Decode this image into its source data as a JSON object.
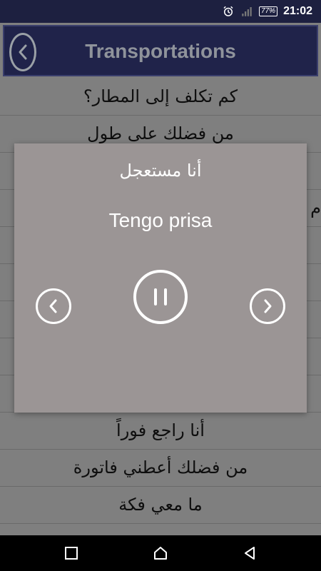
{
  "status_bar": {
    "time": "21:02",
    "battery": "77%",
    "icons": [
      "alarm-icon",
      "signal-icon",
      "battery-icon"
    ]
  },
  "header": {
    "title": "Transportations",
    "back_icon": "chevron-left-icon"
  },
  "phrases": [
    "كم تكلف إلى المطار؟",
    "من فضلك على طول",
    "",
    "م",
    "",
    "",
    "",
    "",
    "",
    "أنا راجع فوراً",
    "من فضلك أعطني فاتورة",
    "ما معي فكة",
    ""
  ],
  "dialog": {
    "arabic": "أنا مستعجل",
    "translation": "Tengo prisa",
    "prev_icon": "chevron-left-icon",
    "pause_icon": "pause-icon",
    "next_icon": "chevron-right-icon"
  },
  "nav_bar": {
    "icons": [
      "recents-icon",
      "home-icon",
      "back-icon"
    ]
  },
  "colors": {
    "status_bar": "#1d2040",
    "header": "#20234a",
    "dim_background": "#7f7f7f",
    "dialog": "#9b9595",
    "nav_bar": "#000000"
  }
}
